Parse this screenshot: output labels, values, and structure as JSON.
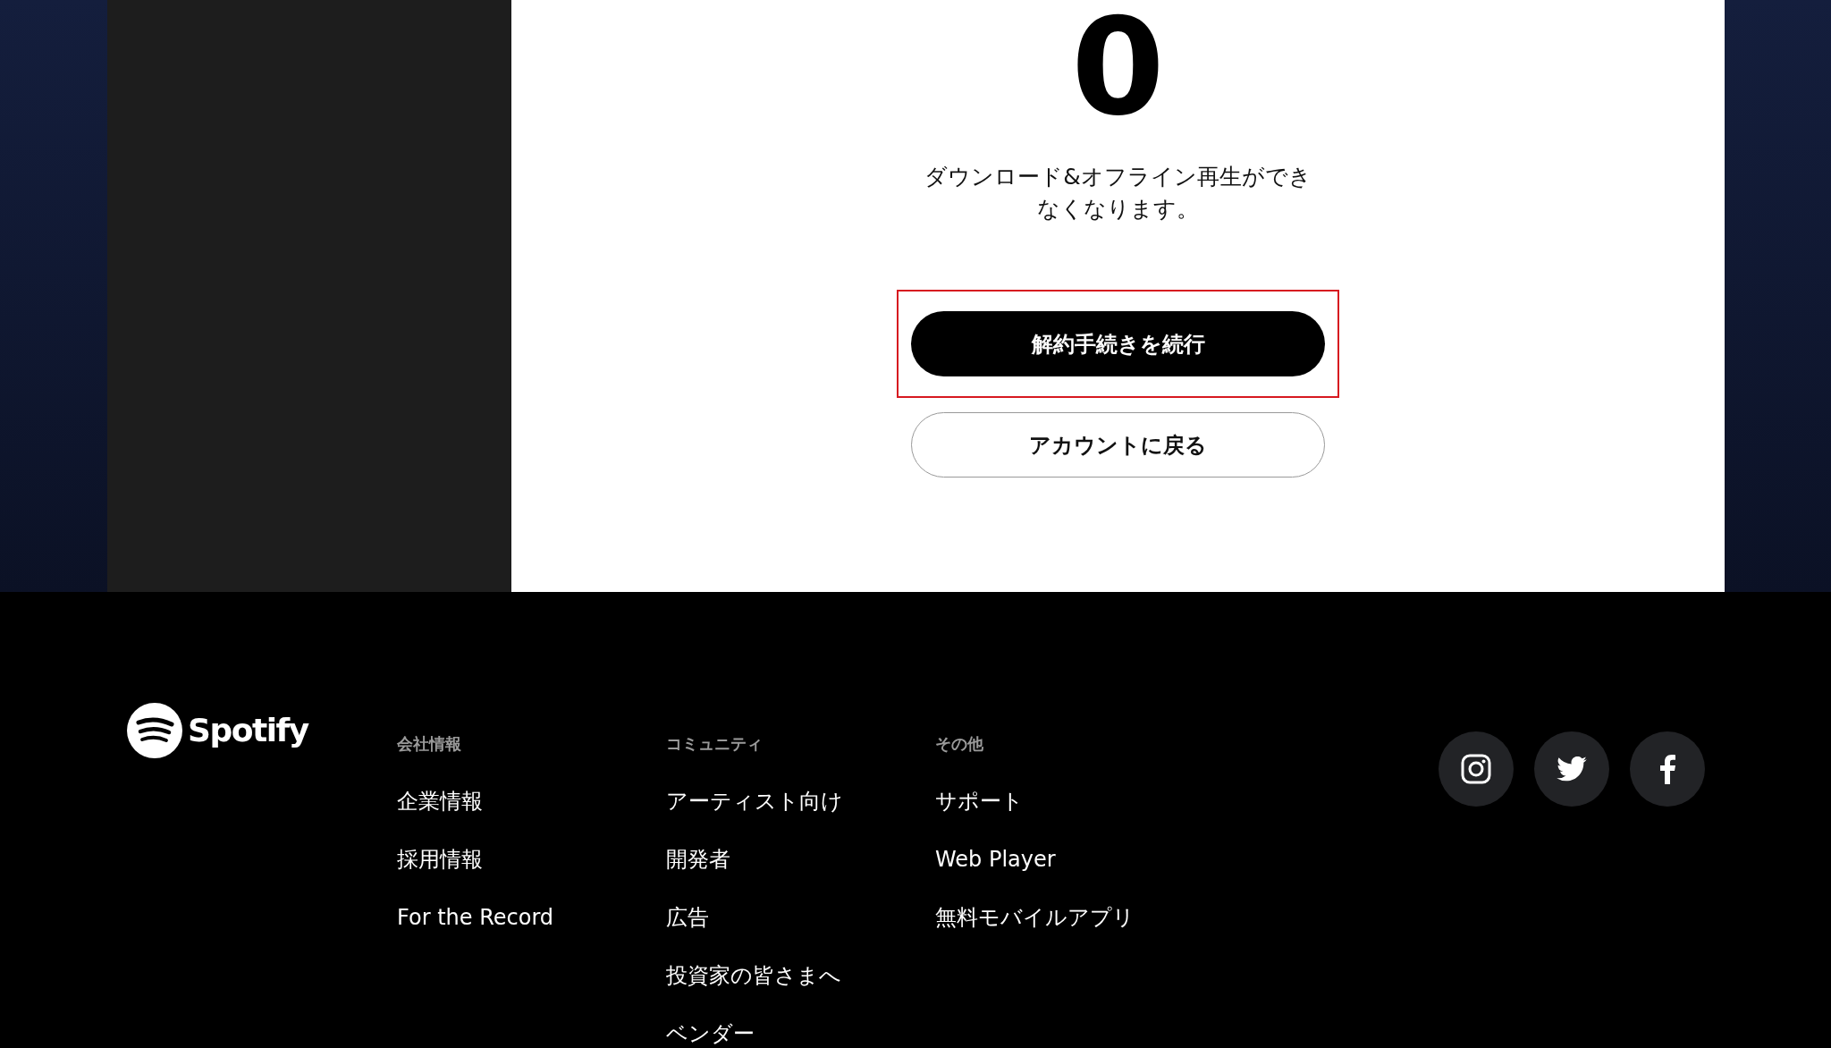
{
  "dialog": {
    "big_number": "0",
    "message": "ダウンロード&オフライン再生ができなくなります。",
    "buttons": [
      {
        "label": "解約手続きを続行",
        "kind": "primary",
        "highlighted": true
      },
      {
        "label": "アカウントに戻る",
        "kind": "outline",
        "highlighted": false
      }
    ]
  },
  "footer": {
    "brand": "Spotify",
    "columns": [
      {
        "heading": "会社情報",
        "links": [
          "企業情報",
          "採用情報",
          "For the Record"
        ]
      },
      {
        "heading": "コミュニティ",
        "links": [
          "アーティスト向け",
          "開発者",
          "広告",
          "投資家の皆さまへ",
          "ベンダー"
        ]
      },
      {
        "heading": "その他",
        "links": [
          "サポート",
          "Web Player",
          "無料モバイルアプリ"
        ]
      }
    ],
    "social": [
      {
        "kind": "instagram"
      },
      {
        "kind": "twitter"
      },
      {
        "kind": "facebook"
      }
    ]
  }
}
